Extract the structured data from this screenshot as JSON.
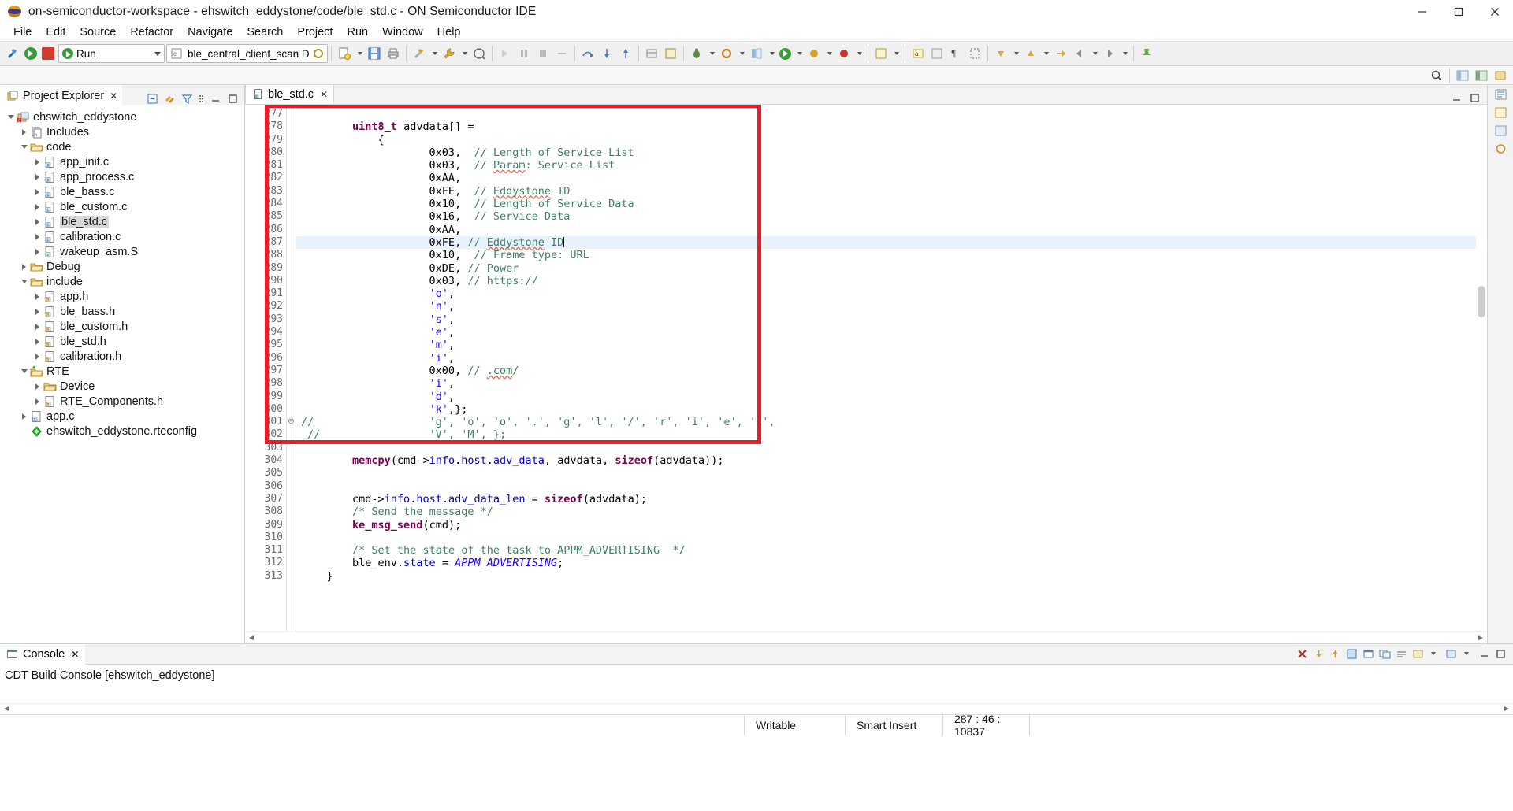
{
  "window": {
    "title": "on-semiconductor-workspace - ehswitch_eddystone/code/ble_std.c - ON Semiconductor IDE",
    "app_icon": "onsemi-logo-icon",
    "minimize": "–",
    "maximize": "□",
    "close": "✕"
  },
  "menubar": [
    "File",
    "Edit",
    "Source",
    "Refactor",
    "Navigate",
    "Search",
    "Project",
    "Run",
    "Window",
    "Help"
  ],
  "toolbar": {
    "run_label": "Run",
    "launch_config": "ble_central_client_scan D",
    "new_icon": "new-file-icon",
    "save_icon": "save-icon",
    "print_icon": "print-icon",
    "build_icon": "build-hammer-icon",
    "debug_icon": "debug-bug-icon",
    "run_icon": "run-green-play-icon",
    "stop_icon": "stop-red-square-icon",
    "search_icon": "search-icon"
  },
  "explorer": {
    "title": "Project Explorer",
    "close_glyph": "✕",
    "tools": [
      "collapse-all-icon",
      "link-with-editor-icon",
      "view-filter-icon",
      "view-menu-icon",
      "minimize-view-icon",
      "maximize-view-icon"
    ],
    "tree": [
      {
        "label": "ehswitch_eddystone",
        "depth": 0,
        "twisty": "open",
        "icon": "c-project-icon",
        "selected": false
      },
      {
        "label": "Includes",
        "depth": 1,
        "twisty": "closed",
        "icon": "includes-icon",
        "selected": false
      },
      {
        "label": "code",
        "depth": 1,
        "twisty": "open",
        "icon": "folder-icon",
        "selected": false
      },
      {
        "label": "app_init.c",
        "depth": 2,
        "twisty": "closed",
        "icon": "c-file-icon",
        "selected": false
      },
      {
        "label": "app_process.c",
        "depth": 2,
        "twisty": "closed",
        "icon": "c-file-icon",
        "selected": false
      },
      {
        "label": "ble_bass.c",
        "depth": 2,
        "twisty": "closed",
        "icon": "c-file-icon",
        "selected": false
      },
      {
        "label": "ble_custom.c",
        "depth": 2,
        "twisty": "closed",
        "icon": "c-file-icon",
        "selected": false
      },
      {
        "label": "ble_std.c",
        "depth": 2,
        "twisty": "closed",
        "icon": "c-file-icon",
        "selected": true
      },
      {
        "label": "calibration.c",
        "depth": 2,
        "twisty": "closed",
        "icon": "c-file-icon",
        "selected": false
      },
      {
        "label": "wakeup_asm.S",
        "depth": 2,
        "twisty": "closed",
        "icon": "s-file-icon",
        "selected": false
      },
      {
        "label": "Debug",
        "depth": 1,
        "twisty": "closed",
        "icon": "folder-icon",
        "selected": false
      },
      {
        "label": "include",
        "depth": 1,
        "twisty": "open",
        "icon": "folder-icon",
        "selected": false
      },
      {
        "label": "app.h",
        "depth": 2,
        "twisty": "closed",
        "icon": "h-file-icon",
        "selected": false
      },
      {
        "label": "ble_bass.h",
        "depth": 2,
        "twisty": "closed",
        "icon": "h-file-icon",
        "selected": false
      },
      {
        "label": "ble_custom.h",
        "depth": 2,
        "twisty": "closed",
        "icon": "h-file-icon",
        "selected": false
      },
      {
        "label": "ble_std.h",
        "depth": 2,
        "twisty": "closed",
        "icon": "h-file-icon",
        "selected": false
      },
      {
        "label": "calibration.h",
        "depth": 2,
        "twisty": "closed",
        "icon": "h-file-icon",
        "selected": false
      },
      {
        "label": "RTE",
        "depth": 1,
        "twisty": "open",
        "icon": "rte-folder-icon",
        "selected": false
      },
      {
        "label": "Device",
        "depth": 2,
        "twisty": "closed",
        "icon": "folder-icon",
        "selected": false
      },
      {
        "label": "RTE_Components.h",
        "depth": 2,
        "twisty": "closed",
        "icon": "h-file-icon",
        "selected": false
      },
      {
        "label": "app.c",
        "depth": 1,
        "twisty": "closed",
        "icon": "c-file-icon",
        "selected": false
      },
      {
        "label": "ehswitch_eddystone.rteconfig",
        "depth": 1,
        "twisty": "none",
        "icon": "rteconfig-icon",
        "selected": false
      }
    ]
  },
  "editor": {
    "tab": {
      "label": "ble_std.c",
      "icon": "c-file-icon",
      "close_glyph": "✕"
    },
    "first_line_number": 277,
    "current_line": 287,
    "lines": [
      {
        "n": 277,
        "segs": []
      },
      {
        "n": 278,
        "segs": [
          {
            "t": "        ",
            "c": ""
          },
          {
            "t": "uint8_t",
            "c": "kw"
          },
          {
            "t": " advdata[] =",
            "c": ""
          }
        ]
      },
      {
        "n": 279,
        "segs": [
          {
            "t": "            {",
            "c": ""
          }
        ]
      },
      {
        "n": 280,
        "segs": [
          {
            "t": "                    0x03,  ",
            "c": ""
          },
          {
            "t": "// Length of Service List",
            "c": "cmt"
          }
        ]
      },
      {
        "n": 281,
        "segs": [
          {
            "t": "                    0x03,  ",
            "c": ""
          },
          {
            "t": "// ",
            "c": "cmt"
          },
          {
            "t": "Param",
            "c": "cmt sq"
          },
          {
            "t": ": Service List",
            "c": "cmt"
          }
        ]
      },
      {
        "n": 282,
        "segs": [
          {
            "t": "                    0xAA,",
            "c": ""
          }
        ]
      },
      {
        "n": 283,
        "segs": [
          {
            "t": "                    0xFE,  ",
            "c": ""
          },
          {
            "t": "// ",
            "c": "cmt"
          },
          {
            "t": "Eddystone",
            "c": "cmt sq"
          },
          {
            "t": " ID",
            "c": "cmt"
          }
        ]
      },
      {
        "n": 284,
        "segs": [
          {
            "t": "                    0x10,  ",
            "c": ""
          },
          {
            "t": "// Length of Service Data",
            "c": "cmt"
          }
        ]
      },
      {
        "n": 285,
        "segs": [
          {
            "t": "                    0x16,  ",
            "c": ""
          },
          {
            "t": "// Service Data",
            "c": "cmt"
          }
        ]
      },
      {
        "n": 286,
        "segs": [
          {
            "t": "                    0xAA,",
            "c": ""
          }
        ]
      },
      {
        "n": 287,
        "segs": [
          {
            "t": "                    0xFE, ",
            "c": ""
          },
          {
            "t": "// ",
            "c": "cmt"
          },
          {
            "t": "Eddystone",
            "c": "cmt sq"
          },
          {
            "t": " ID",
            "c": "cmt"
          }
        ],
        "cur": true,
        "caret": true
      },
      {
        "n": 288,
        "segs": [
          {
            "t": "                    0x10,  ",
            "c": ""
          },
          {
            "t": "// Frame type: URL",
            "c": "cmt"
          }
        ]
      },
      {
        "n": 289,
        "segs": [
          {
            "t": "                    0xDE, ",
            "c": ""
          },
          {
            "t": "// Power",
            "c": "cmt"
          }
        ]
      },
      {
        "n": 290,
        "segs": [
          {
            "t": "                    0x03, ",
            "c": ""
          },
          {
            "t": "// https://",
            "c": "cmt"
          }
        ]
      },
      {
        "n": 291,
        "segs": [
          {
            "t": "                    ",
            "c": ""
          },
          {
            "t": "'o'",
            "c": "str"
          },
          {
            "t": ",",
            "c": ""
          }
        ]
      },
      {
        "n": 292,
        "segs": [
          {
            "t": "                    ",
            "c": ""
          },
          {
            "t": "'n'",
            "c": "str"
          },
          {
            "t": ",",
            "c": ""
          }
        ]
      },
      {
        "n": 293,
        "segs": [
          {
            "t": "                    ",
            "c": ""
          },
          {
            "t": "'s'",
            "c": "str"
          },
          {
            "t": ",",
            "c": ""
          }
        ]
      },
      {
        "n": 294,
        "segs": [
          {
            "t": "                    ",
            "c": ""
          },
          {
            "t": "'e'",
            "c": "str"
          },
          {
            "t": ",",
            "c": ""
          }
        ]
      },
      {
        "n": 295,
        "segs": [
          {
            "t": "                    ",
            "c": ""
          },
          {
            "t": "'m'",
            "c": "str"
          },
          {
            "t": ",",
            "c": ""
          }
        ]
      },
      {
        "n": 296,
        "segs": [
          {
            "t": "                    ",
            "c": ""
          },
          {
            "t": "'i'",
            "c": "str"
          },
          {
            "t": ",",
            "c": ""
          }
        ]
      },
      {
        "n": 297,
        "segs": [
          {
            "t": "                    0x00, ",
            "c": ""
          },
          {
            "t": "// ",
            "c": "cmt"
          },
          {
            "t": ".com",
            "c": "cmt sq"
          },
          {
            "t": "/",
            "c": "cmt"
          }
        ]
      },
      {
        "n": 298,
        "segs": [
          {
            "t": "                    ",
            "c": ""
          },
          {
            "t": "'i'",
            "c": "str"
          },
          {
            "t": ",",
            "c": ""
          }
        ]
      },
      {
        "n": 299,
        "segs": [
          {
            "t": "                    ",
            "c": ""
          },
          {
            "t": "'d'",
            "c": "str"
          },
          {
            "t": ",",
            "c": ""
          }
        ]
      },
      {
        "n": 300,
        "segs": [
          {
            "t": "                    ",
            "c": ""
          },
          {
            "t": "'k'",
            "c": "str"
          },
          {
            "t": ",};",
            "c": ""
          }
        ]
      },
      {
        "n": 301,
        "segs": [
          {
            "t": "//                  'g', 'o', 'o', '.', 'g', 'l', '/', 'r', 'i', 'e', 's',",
            "c": "cmt"
          }
        ],
        "fold": true
      },
      {
        "n": 302,
        "segs": [
          {
            "t": " //                 'V', 'M', };",
            "c": "cmt"
          }
        ]
      },
      {
        "n": 303,
        "segs": []
      },
      {
        "n": 304,
        "segs": [
          {
            "t": "        ",
            "c": ""
          },
          {
            "t": "memcpy",
            "c": "kw"
          },
          {
            "t": "(cmd->",
            "c": ""
          },
          {
            "t": "info",
            "c": "fld"
          },
          {
            "t": ".",
            "c": ""
          },
          {
            "t": "host",
            "c": "fld"
          },
          {
            "t": ".",
            "c": ""
          },
          {
            "t": "adv_data",
            "c": "fld"
          },
          {
            "t": ", advdata, ",
            "c": ""
          },
          {
            "t": "sizeof",
            "c": "kw"
          },
          {
            "t": "(advdata));",
            "c": ""
          }
        ]
      },
      {
        "n": 305,
        "segs": []
      },
      {
        "n": 306,
        "segs": []
      },
      {
        "n": 307,
        "segs": [
          {
            "t": "        cmd->",
            "c": ""
          },
          {
            "t": "info",
            "c": "fld"
          },
          {
            "t": ".",
            "c": ""
          },
          {
            "t": "host",
            "c": "fld"
          },
          {
            "t": ".",
            "c": ""
          },
          {
            "t": "adv_data_len",
            "c": "fld"
          },
          {
            "t": " = ",
            "c": ""
          },
          {
            "t": "sizeof",
            "c": "kw"
          },
          {
            "t": "(advdata);",
            "c": ""
          }
        ]
      },
      {
        "n": 308,
        "segs": [
          {
            "t": "        ",
            "c": ""
          },
          {
            "t": "/* Send the message */",
            "c": "cmt"
          }
        ]
      },
      {
        "n": 309,
        "segs": [
          {
            "t": "        ",
            "c": ""
          },
          {
            "t": "ke_msg_send",
            "c": "kw"
          },
          {
            "t": "(cmd);",
            "c": ""
          }
        ]
      },
      {
        "n": 310,
        "segs": []
      },
      {
        "n": 311,
        "segs": [
          {
            "t": "        ",
            "c": ""
          },
          {
            "t": "/* Set the state of the task to APPM_ADVERTISING  */",
            "c": "cmt"
          }
        ]
      },
      {
        "n": 312,
        "segs": [
          {
            "t": "        ble_env.",
            "c": ""
          },
          {
            "t": "state",
            "c": "fld"
          },
          {
            "t": " = ",
            "c": ""
          },
          {
            "t": "APPM_ADVERTISING",
            "c": "itl"
          },
          {
            "t": ";",
            "c": ""
          }
        ]
      },
      {
        "n": 313,
        "segs": [
          {
            "t": "    }",
            "c": ""
          }
        ]
      }
    ],
    "highlight_box": {
      "color": "#ed1c24",
      "label": "advdata-array-highlight"
    }
  },
  "console": {
    "tab_label": "Console",
    "close_glyph": "✕",
    "body_text": "CDT Build Console [ehswitch_eddystone]",
    "tools": [
      "clear-console-icon",
      "scroll-lock-icon",
      "pin-console-icon",
      "display-selected-console-icon",
      "open-console-icon",
      "word-wrap-icon",
      "new-console-view-icon",
      "minimize-icon",
      "maximize-icon"
    ]
  },
  "statusbar": {
    "writable": "Writable",
    "insert_mode": "Smart Insert",
    "position": "287 : 46 : 10837"
  },
  "colors": {
    "accent_red": "#ed1c24",
    "toolbar_bg": "#f0f0f0",
    "selection_blue": "#e8f2fd",
    "comment_green": "#3f7f5f",
    "string_blue": "#2a00ff",
    "keyword_purple": "#7b0052"
  }
}
